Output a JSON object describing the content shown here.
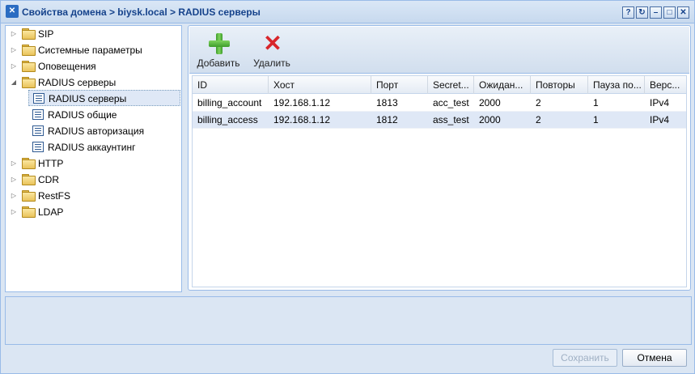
{
  "window": {
    "title": "Свойства домена > biysk.local > RADIUS серверы",
    "buttons": [
      "?",
      "↻",
      "–",
      "□",
      "✕"
    ]
  },
  "tree": {
    "items": [
      {
        "label": "SIP",
        "type": "folder",
        "expand": "▷"
      },
      {
        "label": "Системные параметры",
        "type": "folder",
        "expand": "▷"
      },
      {
        "label": "Оповещения",
        "type": "folder",
        "expand": "▷"
      },
      {
        "label": "RADIUS серверы",
        "type": "folder-open",
        "expand": "◢"
      },
      {
        "label": "RADIUS серверы",
        "type": "leaf",
        "selected": true
      },
      {
        "label": "RADIUS общие",
        "type": "leaf"
      },
      {
        "label": "RADIUS авторизация",
        "type": "leaf"
      },
      {
        "label": "RADIUS аккаунтинг",
        "type": "leaf"
      },
      {
        "label": "HTTP",
        "type": "folder",
        "expand": "▷"
      },
      {
        "label": "CDR",
        "type": "folder",
        "expand": "▷"
      },
      {
        "label": "RestFS",
        "type": "folder",
        "expand": "▷"
      },
      {
        "label": "LDAP",
        "type": "folder",
        "expand": "▷"
      }
    ]
  },
  "toolbar": {
    "add_label": "Добавить",
    "delete_label": "Удалить"
  },
  "grid": {
    "columns": [
      "ID",
      "Хост",
      "Порт",
      "Secret...",
      "Ожидан...",
      "Повторы",
      "Пауза по...",
      "Верс..."
    ],
    "rows": [
      [
        "billing_account",
        "192.168.1.12",
        "1813",
        "acc_test",
        "2000",
        "2",
        "1",
        "IPv4"
      ],
      [
        "billing_access",
        "192.168.1.12",
        "1812",
        "ass_test",
        "2000",
        "2",
        "1",
        "IPv4"
      ]
    ],
    "selected_row": 1
  },
  "footer": {
    "save_label": "Сохранить",
    "cancel_label": "Отмена"
  }
}
